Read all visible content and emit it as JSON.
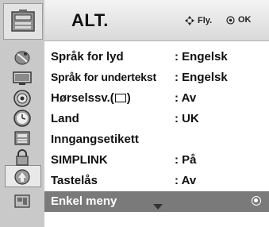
{
  "header": {
    "title": "ALT.",
    "move_hint": "Fly.",
    "ok_hint": "OK"
  },
  "sidebar": {
    "icons": [
      "tv-setup-icon",
      "satellite-icon",
      "monitor-icon",
      "speaker-icon",
      "clock-icon",
      "option-icon",
      "lock-icon",
      "input-icon",
      "usb-icon"
    ],
    "selected": "option-icon"
  },
  "menu": {
    "items": [
      {
        "label": "Språk for lyd",
        "value": ": Engelsk"
      },
      {
        "label": "Språk for undertekst",
        "value": ": Engelsk"
      },
      {
        "label": "Hørselssv.(",
        "label_suffix": ")",
        "value": ": Av"
      },
      {
        "label": "Land",
        "value": ": UK"
      },
      {
        "label": "Inngangsetikett",
        "value": ""
      },
      {
        "label": "SIMPLINK",
        "value": ": På"
      },
      {
        "label": "Tastelås",
        "value": ": Av"
      },
      {
        "label": "Enkel meny",
        "value": ""
      }
    ],
    "selected_index": 7
  }
}
